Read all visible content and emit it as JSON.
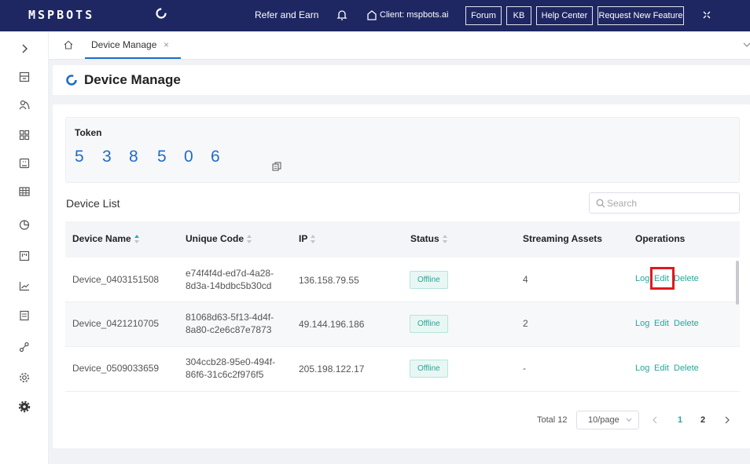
{
  "topbar": {
    "logo_text": "MSPBOTS",
    "refer_label": "Refer and Earn",
    "client_label": "Client: mspbots.ai",
    "forum_label": "Forum",
    "kb_label": "KB",
    "help_label": "Help Center",
    "request_label": "Request New Feature",
    "bg_color": "#1e2761"
  },
  "tabs": [
    {
      "label": "Device Manage",
      "close": "×"
    }
  ],
  "page": {
    "title": "Device Manage"
  },
  "token": {
    "label": "Token",
    "digits": [
      "5",
      "3",
      "8",
      "5",
      "0",
      "6"
    ]
  },
  "device_list": {
    "title": "Device List",
    "search_placeholder": "Search"
  },
  "table": {
    "headers": {
      "device_name": "Device Name",
      "unique_code": "Unique Code",
      "ip": "IP",
      "status": "Status",
      "streaming_assets": "Streaming Assets",
      "operations": "Operations"
    },
    "rows": [
      {
        "device_name": "Device_0403151508",
        "code_line1": "e74f4f4d-ed7d-4a28-",
        "code_line2": "8d3a-14bdbc5b30cd",
        "ip": "136.158.79.55",
        "status": "Offline",
        "streaming_assets": "4",
        "op_log": "Log",
        "op_edit": "Edit",
        "op_delete": "Delete"
      },
      {
        "device_name": "Device_0421210705",
        "code_line1": "81068d63-5f13-4d4f-",
        "code_line2": "8a80-c2e6c87e7873",
        "ip": "49.144.196.186",
        "status": "Offline",
        "streaming_assets": "2",
        "op_log": "Log",
        "op_edit": "Edit",
        "op_delete": "Delete"
      },
      {
        "device_name": "Device_0509033659",
        "code_line1": "304ccb28-95e0-494f-",
        "code_line2": "86f6-31c6c2f976f5",
        "ip": "205.198.122.17",
        "status": "Offline",
        "streaming_assets": "-",
        "op_log": "Log",
        "op_edit": "Edit",
        "op_delete": "Delete"
      }
    ]
  },
  "pagination": {
    "total": "Total 12",
    "page_size": "10/page",
    "pages": [
      "1",
      "2"
    ],
    "current_page": "1"
  },
  "colors": {
    "accent": "#26a69a",
    "token_blue": "#1e6cc8",
    "highlight_red": "#e0191f"
  }
}
